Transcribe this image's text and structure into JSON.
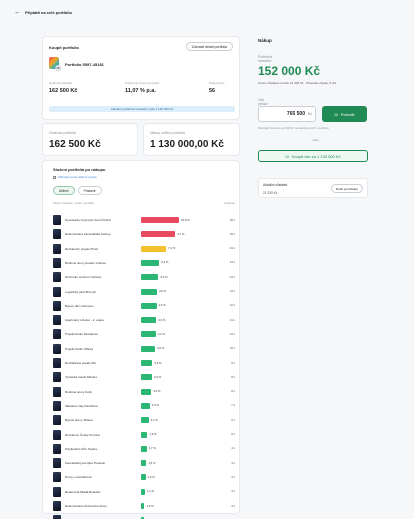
{
  "topbar": {
    "back_icon": "arrow-left-icon",
    "title": "Připlatit na celé portfolio"
  },
  "portfolio_card": {
    "heading": "Koupit portfolio",
    "action_button": "Zobrazit detail portfolia",
    "portfolio_name": "Portfolio 5597-45181",
    "badge": "56",
    "stats": [
      {
        "label": "Hodnota portfolia",
        "value": "162 500 Kč"
      },
      {
        "label": "Průměrný výnos na pozici",
        "value": "11,07 % p.a."
      },
      {
        "label": "Počet pozic",
        "value": "56"
      }
    ],
    "note": "Aktuální potřebná investiční výše 1 130 000 Kč"
  },
  "value_cards": [
    {
      "label": "Hodnota portfolia",
      "value": "162 500 Kč"
    },
    {
      "label": "Nákup celého portfolia",
      "value": "1 130 000,00 Kč"
    }
  ],
  "holdings": {
    "title": "Složení portfolia po nákupu",
    "link": "Zobrazit pouze aktivní pozice",
    "tabs": [
      {
        "label": "Aktivní",
        "active": true
      },
      {
        "label": "Prodané",
        "active": false
      }
    ],
    "columns": {
      "left": "Název investice / podíl v portfoliu",
      "right": "Hodnota"
    },
    "rows": [
      {
        "name": "Novostavby bytových domů Praha",
        "pct": "10,8 %",
        "value": "29 k",
        "frac": 1.0,
        "color": "#e84a5f"
      },
      {
        "name": "Rekonstrukce kancelářské budovy",
        "pct": "9,7 %",
        "value": "26 k",
        "frac": 0.9,
        "color": "#e84a5f"
      },
      {
        "name": "Rezidenční projekt Plzeň",
        "pct": "7,1 %",
        "value": "19 k",
        "frac": 0.66,
        "color": "#f2c12e"
      },
      {
        "name": "Rodinné domy Hradec Králové",
        "pct": "5,2 %",
        "value": "14 k",
        "frac": 0.48,
        "color": "#2bb673"
      },
      {
        "name": "Obchodní centrum Ostrava",
        "pct": "5,0 %",
        "value": "13 k",
        "frac": 0.46,
        "color": "#2bb673"
      },
      {
        "name": "Logistický park Brno-jih",
        "pct": "4,6 %",
        "value": "12 k",
        "frac": 0.42,
        "color": "#2bb673"
      },
      {
        "name": "Bytový dům Olomouc",
        "pct": "4,5 %",
        "value": "12 k",
        "frac": 0.41,
        "color": "#2bb673"
      },
      {
        "name": "Apartmány Liberec - 2. etapa",
        "pct": "4,3 %",
        "value": "11 k",
        "frac": 0.4,
        "color": "#2bb673"
      },
      {
        "name": "Projekt Karlín Residence",
        "pct": "4,2 %",
        "value": "11 k",
        "frac": 0.39,
        "color": "#2bb673"
      },
      {
        "name": "Projekt Karlín Offices",
        "pct": "4,0 %",
        "value": "10 k",
        "frac": 0.37,
        "color": "#2bb673"
      },
      {
        "name": "Revitalizace areálu Zlín",
        "pct": "3,3 %",
        "value": "9 k",
        "frac": 0.3,
        "color": "#2bb673"
      },
      {
        "name": "Výstavba hotelu Mikulov",
        "pct": "3,2 %",
        "value": "8 k",
        "frac": 0.29,
        "color": "#2bb673"
      },
      {
        "name": "Rodinné domy Kolín",
        "pct": "3,0 %",
        "value": "8 k",
        "frac": 0.27,
        "color": "#2bb673"
      },
      {
        "name": "Skladové haly Pardubice",
        "pct": "2,5 %",
        "value": "7 k",
        "frac": 0.23,
        "color": "#2bb673"
      },
      {
        "name": "Bytové domy Jihlava",
        "pct": "2,2 %",
        "value": "6 k",
        "frac": 0.2,
        "color": "#2bb673"
      },
      {
        "name": "Rezidence Český Krumlov",
        "pct": "1,9 %",
        "value": "5 k",
        "frac": 0.17,
        "color": "#2bb673"
      },
      {
        "name": "Polyfunkční dům Teplice",
        "pct": "1,7 %",
        "value": "4 k",
        "frac": 0.15,
        "color": "#2bb673"
      },
      {
        "name": "Kancelářský komplex Pankrác",
        "pct": "1,5 %",
        "value": "4 k",
        "frac": 0.14,
        "color": "#2bb673"
      },
      {
        "name": "Domy u lesa Beroun",
        "pct": "1,3 %",
        "value": "3 k",
        "frac": 0.12,
        "color": "#2bb673"
      },
      {
        "name": "Retail park Mladá Boleslav",
        "pct": "1,1 %",
        "value": "3 k",
        "frac": 0.1,
        "color": "#2bb673"
      },
      {
        "name": "Rekonstrukce činžovního domu",
        "pct": "1,0 %",
        "value": "3 k",
        "frac": 0.09,
        "color": "#2bb673"
      },
      {
        "name": "Developerský projekt Kladno",
        "pct": "0,8 %",
        "value": "2 k",
        "frac": 0.08,
        "color": "#2bb673"
      }
    ]
  },
  "buy_panel": {
    "title": "Nákup",
    "label_total": "Potřebná investice",
    "total": "152 000 Kč",
    "sub": "Z toho zůstatek na účtu 21 330 Kč · Převeďte zbytek, 5 dní",
    "label_amount": "Váš příkaz",
    "amount": "765 500",
    "currency": "Kč",
    "confirm": "Potvrdit",
    "hint": "Minimální investice je 500 Kč na každou pozici v portfoliu.",
    "or": "nebo",
    "buy_all": "Koupit vše za 1 130 000 Kč",
    "account_title": "Aktuální zůstatek",
    "account_value": "21 330 Kč",
    "account_button": "Dobít prostředky"
  }
}
